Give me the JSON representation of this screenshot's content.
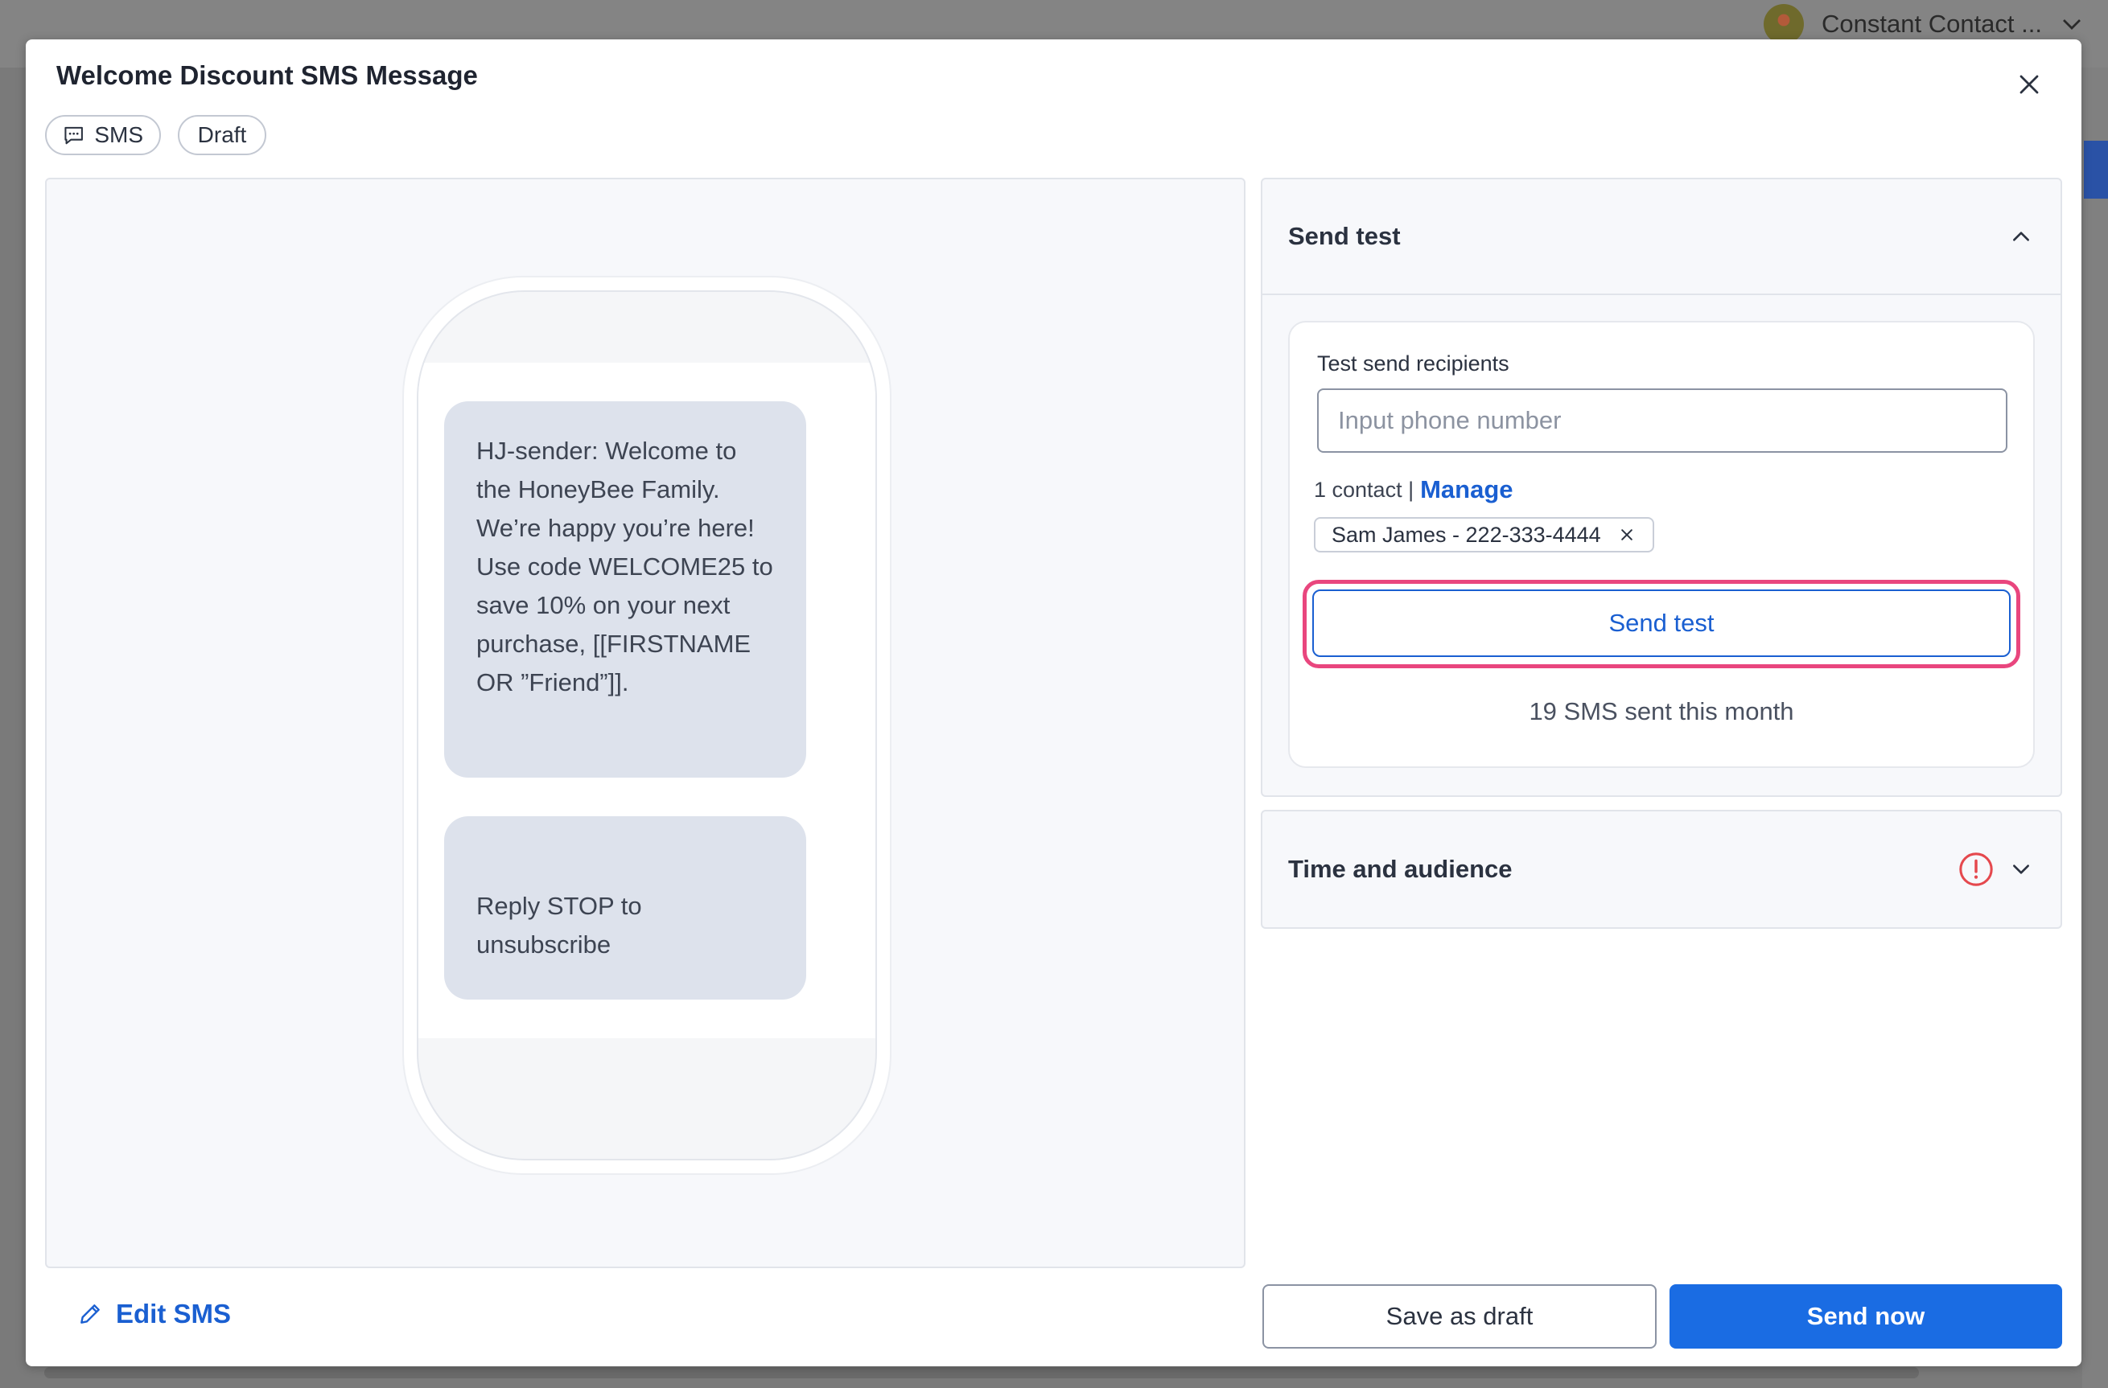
{
  "background": {
    "account_name": "Constant Contact ...",
    "icons": {
      "avatar": "account-avatar",
      "chevron": "chevron-down-icon"
    }
  },
  "modal": {
    "title": "Welcome Discount SMS Message",
    "chips": {
      "channel": "SMS",
      "status": "Draft"
    },
    "icons": {
      "close": "close-icon",
      "chat": "chat-bubble-icon",
      "pencil": "pencil-icon"
    }
  },
  "preview": {
    "messages": [
      "HJ-sender: Welcome to the HoneyBee Family. We’re happy you’re here! Use code WELCOME25 to save 10% on your next purchase, [[FIRSTNAME OR ”Friend”]].",
      "Reply STOP to unsubscribe"
    ],
    "edit_label": "Edit SMS"
  },
  "send_test": {
    "header": "Send test",
    "expanded": true,
    "recipients_label": "Test send recipients",
    "input_placeholder": "Input phone number",
    "input_value": "",
    "contact_count": "1 contact |",
    "manage_label": "Manage",
    "contacts": [
      "Sam James - 222-333-4444"
    ],
    "button_label": "Send test",
    "sent_this_month": "19 SMS sent this month"
  },
  "time_audience": {
    "header": "Time and audience",
    "expanded": false,
    "status_icon": "warning-circle-icon"
  },
  "footer": {
    "save_draft_label": "Save as draft",
    "send_now_label": "Send now"
  },
  "colors": {
    "accent": "#1a6ce3",
    "link": "#1a5fd1",
    "highlight": "#e9467e",
    "warning": "#e5484d",
    "bubble": "#dde2ec"
  }
}
